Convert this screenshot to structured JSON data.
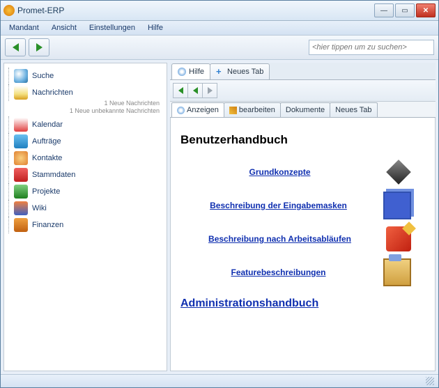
{
  "window": {
    "title": "Promet-ERP"
  },
  "menubar": [
    "Mandant",
    "Ansicht",
    "Einstellungen",
    "Hilfe"
  ],
  "search": {
    "placeholder": "<hier tippen um zu suchen>"
  },
  "sidebar": {
    "items": [
      {
        "label": "Suche"
      },
      {
        "label": "Nachrichten",
        "sub1": "1 Neue Nachrichten",
        "sub2": "1 Neue unbekannte Nachrichten"
      },
      {
        "label": "Kalendar"
      },
      {
        "label": "Aufträge"
      },
      {
        "label": "Kontakte"
      },
      {
        "label": "Stammdaten"
      },
      {
        "label": "Projekte"
      },
      {
        "label": "Wiki"
      },
      {
        "label": "Finanzen"
      }
    ]
  },
  "tabs": {
    "hilfe": "Hilfe",
    "neu": "Neues Tab"
  },
  "subtabs": {
    "anzeigen": "Anzeigen",
    "bearbeiten": "bearbeiten",
    "dokumente": "Dokumente",
    "neu": "Neues Tab"
  },
  "content": {
    "title": "Benutzerhandbuch",
    "links": {
      "l1": "Grundkonzepte",
      "l2": "Beschreibung der Eingabemasken",
      "l3": "Beschreibung nach Arbeitsabläufen",
      "l4": "Featurebeschreibungen"
    },
    "admin": "Administrationshandbuch"
  }
}
